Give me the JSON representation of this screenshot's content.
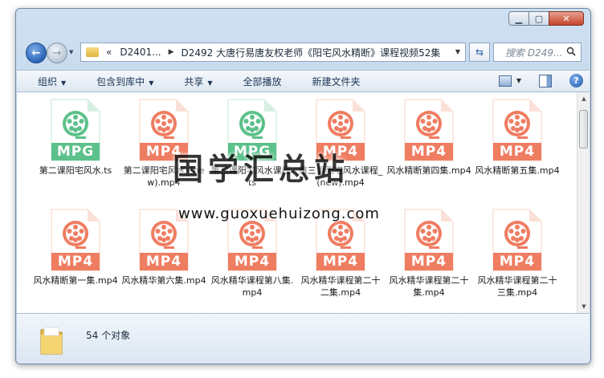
{
  "nav": {
    "address_crumbs": [
      "D2401...",
      "D2492 大唐行易唐友权老师《阳宅风水精断》课程视频52集"
    ],
    "address_prefix": "«",
    "search_placeholder": "搜索 D249..."
  },
  "toolbar": {
    "items": [
      {
        "label": "组织",
        "has_caret": true
      },
      {
        "label": "包含到库中",
        "has_caret": true
      },
      {
        "label": "共享",
        "has_caret": true
      },
      {
        "label": "全部播放",
        "has_caret": false
      },
      {
        "label": "新建文件夹",
        "has_caret": false
      }
    ],
    "help_label": "?"
  },
  "files": [
    {
      "name": "第二课阳宅风水.ts",
      "ext": "MPG",
      "color": "#5cc18a"
    },
    {
      "name": "第二课阳宅风水_(new).mp4",
      "ext": "MP4",
      "color": "#ef7d61"
    },
    {
      "name": "第三课阳宅风水课程.ts",
      "ext": "MPG",
      "color": "#5cc18a"
    },
    {
      "name": "第三课阳宅风水课程_(new).mp4",
      "ext": "MP4",
      "color": "#ef7d61"
    },
    {
      "name": "风水精断第四集.mp4",
      "ext": "MP4",
      "color": "#ef7d61"
    },
    {
      "name": "风水精断第五集.mp4",
      "ext": "MP4",
      "color": "#ef7d61"
    },
    {
      "name": "风水精断第一集.mp4",
      "ext": "MP4",
      "color": "#ef7d61"
    },
    {
      "name": "风水精华第六集.mp4",
      "ext": "MP4",
      "color": "#ef7d61"
    },
    {
      "name": "风水精华课程第八集.mp4",
      "ext": "MP4",
      "color": "#ef7d61"
    },
    {
      "name": "风水精华课程第二十二集.mp4",
      "ext": "MP4",
      "color": "#ef7d61"
    },
    {
      "name": "风水精华课程第二十集.mp4",
      "ext": "MP4",
      "color": "#ef7d61"
    },
    {
      "name": "风水精华课程第二十三集.mp4",
      "ext": "MP4",
      "color": "#ef7d61"
    }
  ],
  "watermark": {
    "title": "国学汇总站",
    "url": "www.guoxuehuizong.com"
  },
  "status": {
    "count_text": "54 个对象"
  }
}
